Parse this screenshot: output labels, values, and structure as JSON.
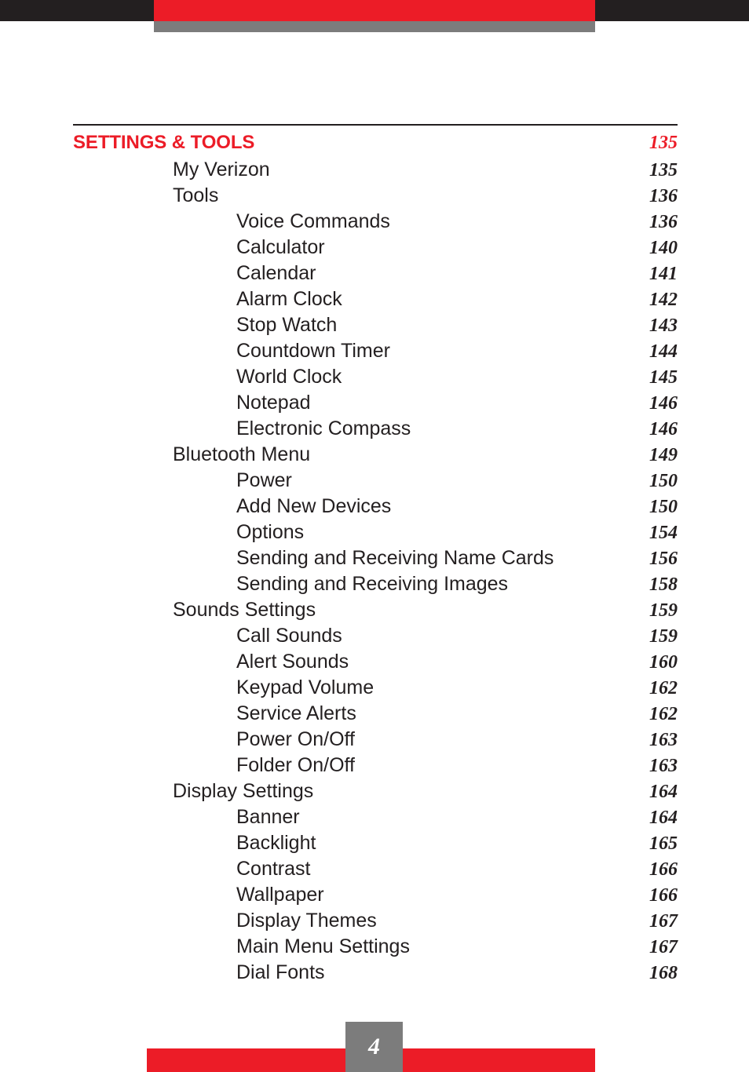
{
  "page": {
    "number": "4",
    "accent_red": "#ec1c27",
    "bar_gray": "#7c7c7c",
    "bar_dark": "#231f20",
    "text_color": "#231f20"
  },
  "toc": {
    "entries": [
      {
        "level": 0,
        "label": "SETTINGS & TOOLS",
        "page": "135"
      },
      {
        "level": 1,
        "label": "My Verizon",
        "page": "135"
      },
      {
        "level": 1,
        "label": "Tools",
        "page": "136"
      },
      {
        "level": 2,
        "label": "Voice Commands",
        "page": "136"
      },
      {
        "level": 2,
        "label": "Calculator",
        "page": "140"
      },
      {
        "level": 2,
        "label": "Calendar",
        "page": "141"
      },
      {
        "level": 2,
        "label": "Alarm Clock",
        "page": "142"
      },
      {
        "level": 2,
        "label": "Stop Watch",
        "page": "143"
      },
      {
        "level": 2,
        "label": "Countdown Timer",
        "page": "144"
      },
      {
        "level": 2,
        "label": "World Clock",
        "page": "145"
      },
      {
        "level": 2,
        "label": "Notepad",
        "page": "146"
      },
      {
        "level": 2,
        "label": "Electronic Compass",
        "page": "146"
      },
      {
        "level": 1,
        "label": "Bluetooth Menu",
        "page": "149"
      },
      {
        "level": 2,
        "label": "Power",
        "page": "150"
      },
      {
        "level": 2,
        "label": "Add New Devices",
        "page": "150"
      },
      {
        "level": 2,
        "label": "Options",
        "page": "154"
      },
      {
        "level": 2,
        "label": "Sending and Receiving Name Cards",
        "page": "156"
      },
      {
        "level": 2,
        "label": "Sending and Receiving Images",
        "page": "158"
      },
      {
        "level": 1,
        "label": "Sounds Settings",
        "page": "159"
      },
      {
        "level": 2,
        "label": "Call Sounds",
        "page": "159"
      },
      {
        "level": 2,
        "label": "Alert Sounds",
        "page": "160"
      },
      {
        "level": 2,
        "label": "Keypad Volume",
        "page": "162"
      },
      {
        "level": 2,
        "label": "Service Alerts",
        "page": "162"
      },
      {
        "level": 2,
        "label": "Power On/Off",
        "page": "163"
      },
      {
        "level": 2,
        "label": "Folder On/Off",
        "page": "163"
      },
      {
        "level": 1,
        "label": "Display Settings",
        "page": "164"
      },
      {
        "level": 2,
        "label": "Banner",
        "page": "164"
      },
      {
        "level": 2,
        "label": "Backlight",
        "page": "165"
      },
      {
        "level": 2,
        "label": "Contrast",
        "page": "166"
      },
      {
        "level": 2,
        "label": "Wallpaper",
        "page": "166"
      },
      {
        "level": 2,
        "label": "Display Themes",
        "page": "167"
      },
      {
        "level": 2,
        "label": "Main Menu Settings",
        "page": "167"
      },
      {
        "level": 2,
        "label": "Dial Fonts",
        "page": "168"
      }
    ]
  }
}
